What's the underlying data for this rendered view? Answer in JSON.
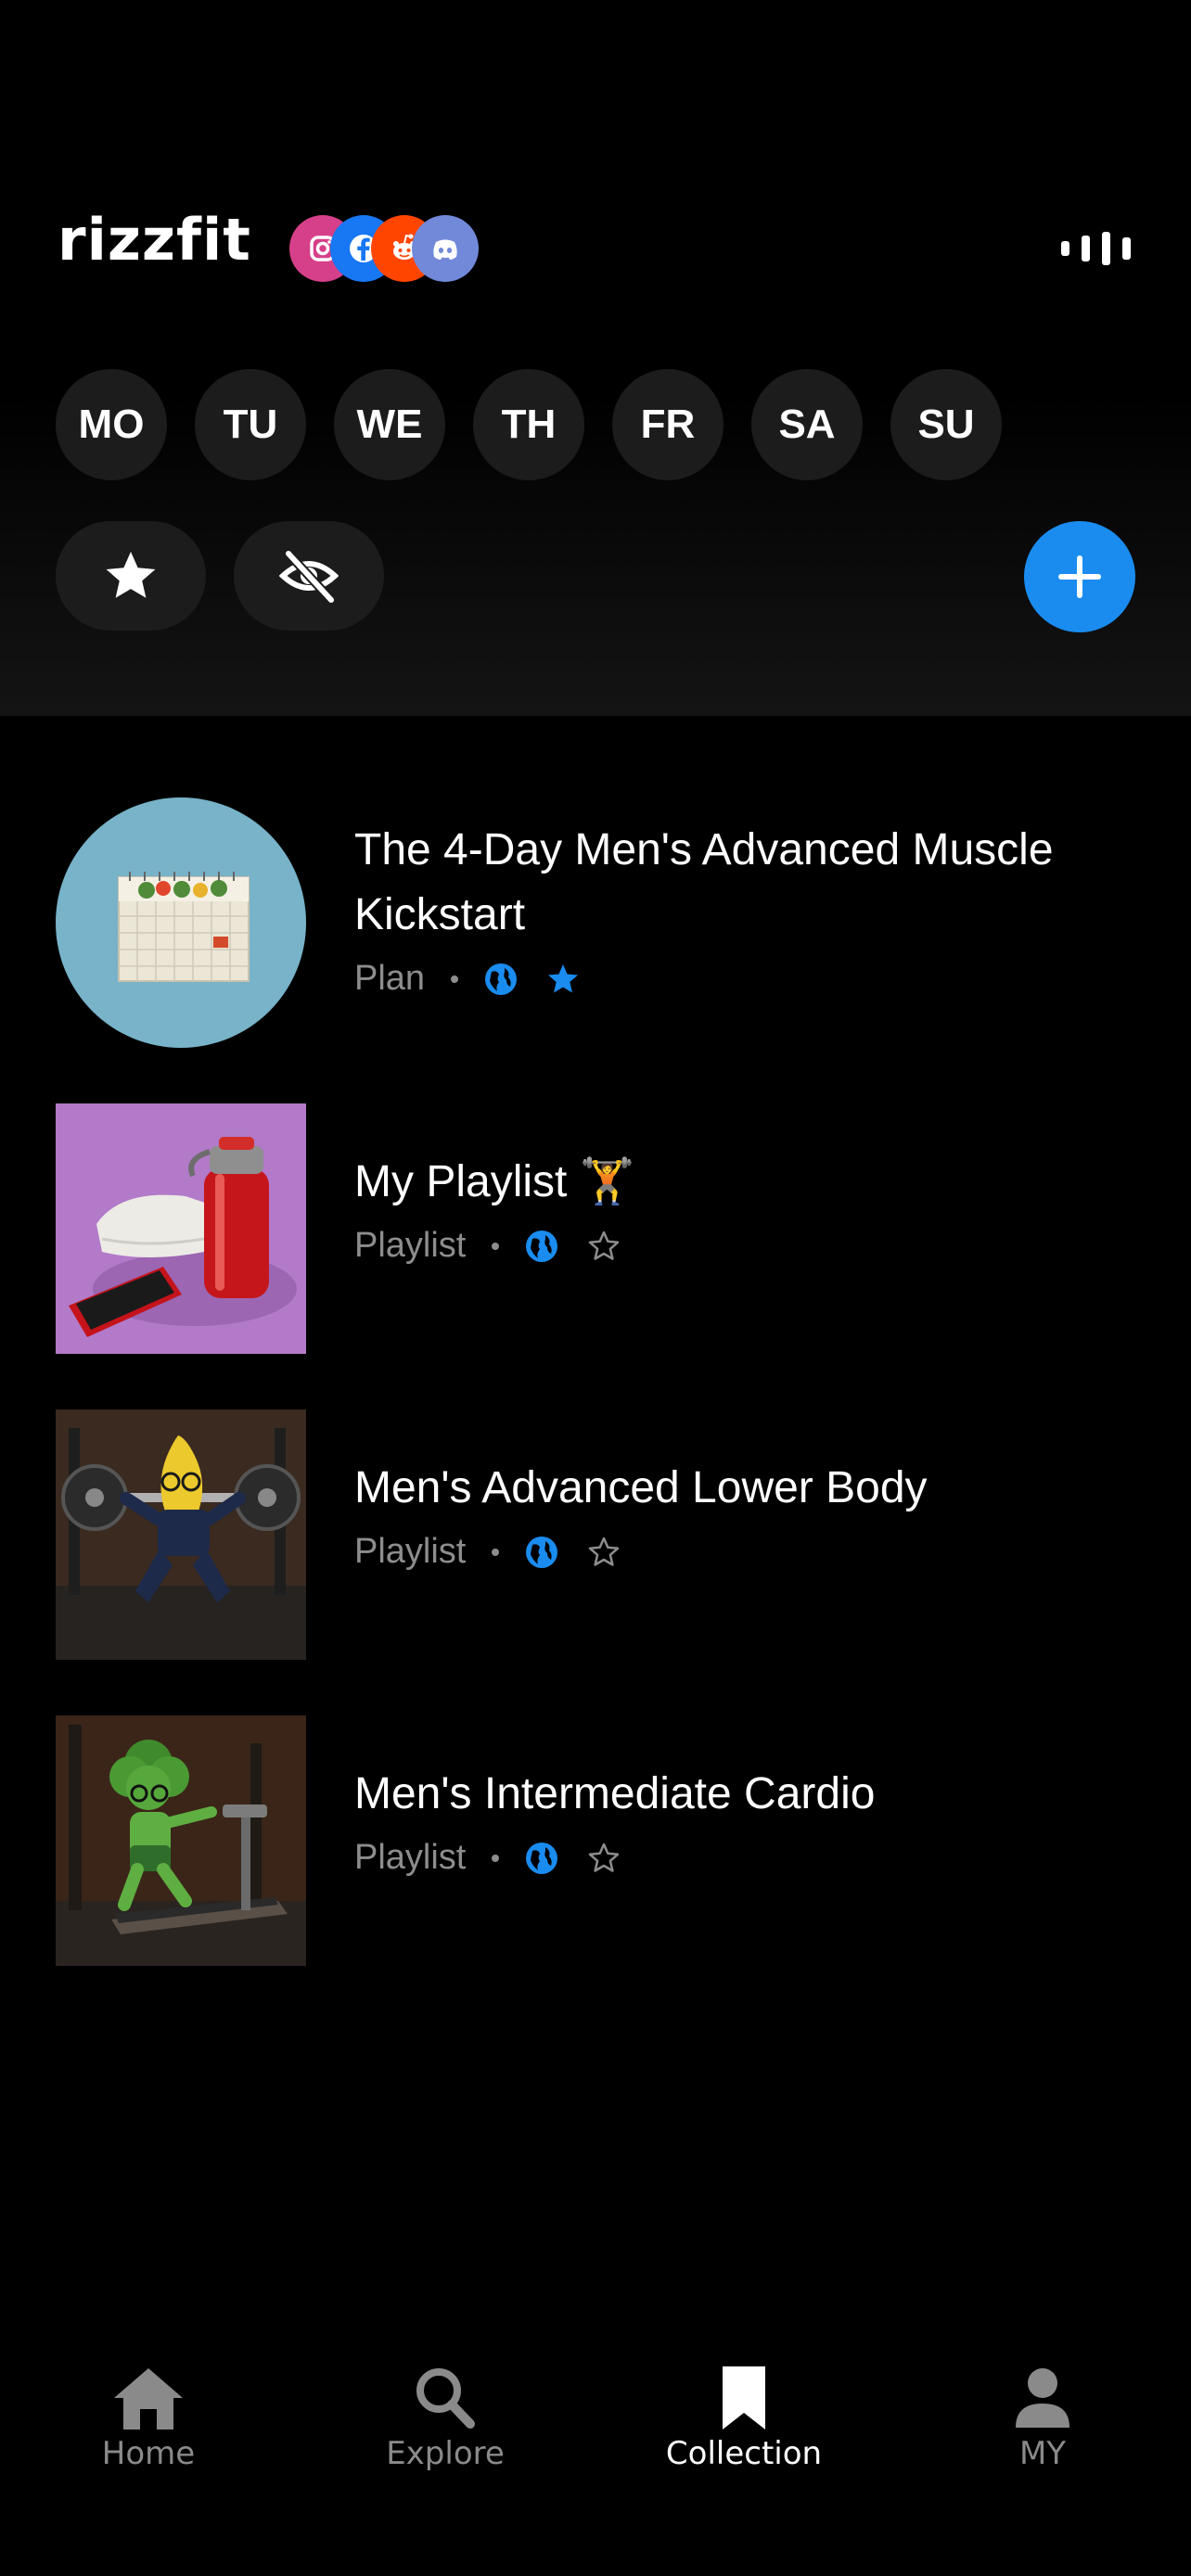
{
  "app": {
    "logo": "rizzfit"
  },
  "social": [
    {
      "name": "instagram",
      "icon": "instagram-icon",
      "color": "#d6408a"
    },
    {
      "name": "facebook",
      "icon": "facebook-icon",
      "color": "#1877f2"
    },
    {
      "name": "reddit",
      "icon": "reddit-icon",
      "color": "#ff4500"
    },
    {
      "name": "discord",
      "icon": "discord-icon",
      "color": "#7289da"
    }
  ],
  "days": [
    "MO",
    "TU",
    "WE",
    "TH",
    "FR",
    "SA",
    "SU"
  ],
  "filters": {
    "favorites_icon": "star-icon",
    "hidden_icon": "eye-off-icon",
    "add_icon": "plus-icon"
  },
  "items": [
    {
      "title": "The 4-Day Men's Advanced Muscle Kickstart",
      "type": "Plan",
      "public": true,
      "starred": true,
      "thumb": "calendar"
    },
    {
      "title": "My Playlist 🏋️",
      "type": "Playlist",
      "public": true,
      "starred": false,
      "thumb": "water-bottle"
    },
    {
      "title": "Men's Advanced Lower Body",
      "type": "Playlist",
      "public": true,
      "starred": false,
      "thumb": "banana-squat"
    },
    {
      "title": "Men's Intermediate Cardio",
      "type": "Playlist",
      "public": true,
      "starred": false,
      "thumb": "broccoli-treadmill"
    }
  ],
  "tabs": [
    {
      "label": "Home",
      "icon": "home-icon",
      "active": false
    },
    {
      "label": "Explore",
      "icon": "search-icon",
      "active": false
    },
    {
      "label": "Collection",
      "icon": "bookmark-icon",
      "active": true
    },
    {
      "label": "MY",
      "icon": "person-icon",
      "active": false
    }
  ],
  "colors": {
    "accent": "#1a8cf0",
    "chip_bg": "#1c1c1c",
    "muted": "#8d8d8d"
  }
}
